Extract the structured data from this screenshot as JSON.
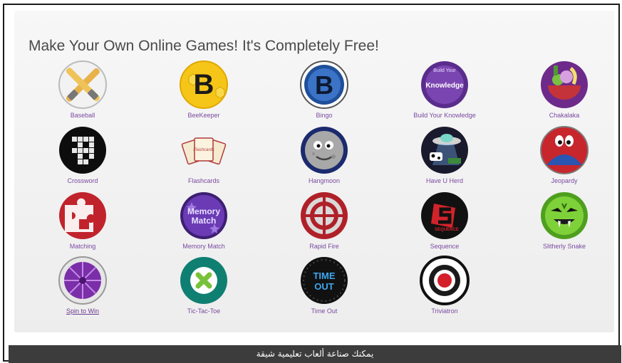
{
  "headline": "Make Your Own Online Games! It's Completely Free!",
  "footer_caption": "يمكنك صناعة ألعاب تعليمية شيقة",
  "games": [
    {
      "label": "Baseball",
      "icon": "baseball-bats-icon"
    },
    {
      "label": "BeeKeeper",
      "icon": "beekeeper-b-icon"
    },
    {
      "label": "Bingo",
      "icon": "bingo-b-icon"
    },
    {
      "label": "Build Your Knowledge",
      "icon": "knowledge-icon",
      "icon_text": "Knowledge",
      "icon_arc": "Build Your"
    },
    {
      "label": "Chakalaka",
      "icon": "fruit-bowl-icon"
    },
    {
      "label": "Crossword",
      "icon": "crossword-grid-icon"
    },
    {
      "label": "Flashcards",
      "icon": "flashcards-icon",
      "icon_text": "Flashcards"
    },
    {
      "label": "Hangmoon",
      "icon": "moon-face-icon"
    },
    {
      "label": "Have U Herd",
      "icon": "ufo-cow-icon"
    },
    {
      "label": "Jeopardy",
      "icon": "jeopardy-eyes-icon"
    },
    {
      "label": "Matching",
      "icon": "puzzle-piece-icon"
    },
    {
      "label": "Memory Match",
      "icon": "memory-match-icon",
      "icon_text_1": "Memory",
      "icon_text_2": "Match"
    },
    {
      "label": "Rapid Fire",
      "icon": "crosshair-icon"
    },
    {
      "label": "Sequence",
      "icon": "sequence-s-icon",
      "icon_text": "SEQUENCE"
    },
    {
      "label": "Slitherly Snake",
      "icon": "snake-face-icon"
    },
    {
      "label": "Spin to Win",
      "icon": "spin-wheel-icon"
    },
    {
      "label": "Tic-Tac-Toe",
      "icon": "x-mark-icon"
    },
    {
      "label": "Time Out",
      "icon": "time-out-icon",
      "icon_text_1": "TIME",
      "icon_text_2": "OUT"
    },
    {
      "label": "Triviatron",
      "icon": "triviatron-target-icon"
    }
  ],
  "colors": {
    "label": "#7a4aa0",
    "headline": "#4a4a4a",
    "footer_bg": "#3c3c3c"
  }
}
